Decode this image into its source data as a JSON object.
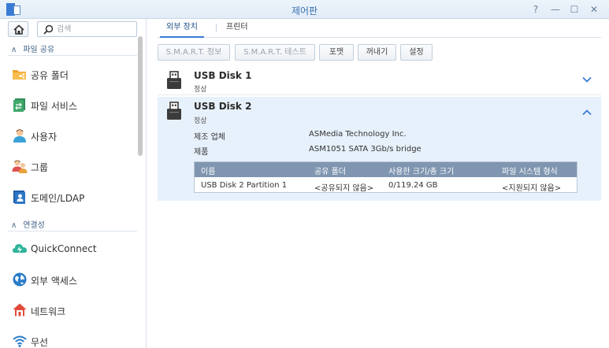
{
  "window": {
    "title": "제어판",
    "buttons": {
      "help": "?",
      "minimize": "—",
      "maximize": "☐",
      "close": "✕"
    }
  },
  "sidebar": {
    "search_placeholder": "검색",
    "sections": [
      {
        "label": "파일 공유"
      },
      {
        "label": "연결성"
      }
    ],
    "items": [
      {
        "label": "공유 폴더",
        "icon": "shared-folder-icon"
      },
      {
        "label": "파일 서비스",
        "icon": "file-services-icon"
      },
      {
        "label": "사용자",
        "icon": "user-icon"
      },
      {
        "label": "그룹",
        "icon": "group-icon"
      },
      {
        "label": "도메인/LDAP",
        "icon": "domain-ldap-icon"
      },
      {
        "label": "QuickConnect",
        "icon": "quickconnect-icon"
      },
      {
        "label": "외부 액세스",
        "icon": "external-access-icon"
      },
      {
        "label": "네트워크",
        "icon": "network-icon"
      },
      {
        "label": "무선",
        "icon": "wireless-icon"
      }
    ]
  },
  "main": {
    "tabs": [
      {
        "label": "외부 장치",
        "active": true
      },
      {
        "label": "프린터",
        "active": false
      }
    ],
    "toolbar": {
      "smart_info": "S.M.A.R.T. 정보",
      "smart_test": "S.M.A.R.T. 테스트",
      "format": "포맷",
      "eject": "꺼내기",
      "settings": "설정"
    },
    "disks": [
      {
        "name": "USB Disk 1",
        "status": "정상",
        "expanded": false
      },
      {
        "name": "USB Disk 2",
        "status": "정상",
        "expanded": true,
        "manufacturer_label": "제조 업체",
        "manufacturer": "ASMedia Technology Inc.",
        "product_label": "제품",
        "product": "ASM1051 SATA 3Gb/s bridge",
        "partitions": {
          "headers": [
            "이름",
            "공유 폴더",
            "사용한 크기/총 크기",
            "파일 시스템 형식"
          ],
          "rows": [
            [
              "USB Disk 2 Partition 1",
              "<공유되지 않음>",
              "0/119.24 GB",
              "<지원되지 않음>"
            ]
          ]
        }
      }
    ]
  },
  "colors": {
    "accent": "#3a7bd5",
    "selected_row_bg": "#e7f1fb",
    "table_header_bg": "#7f95b0",
    "title_text": "#3a6fb0"
  }
}
